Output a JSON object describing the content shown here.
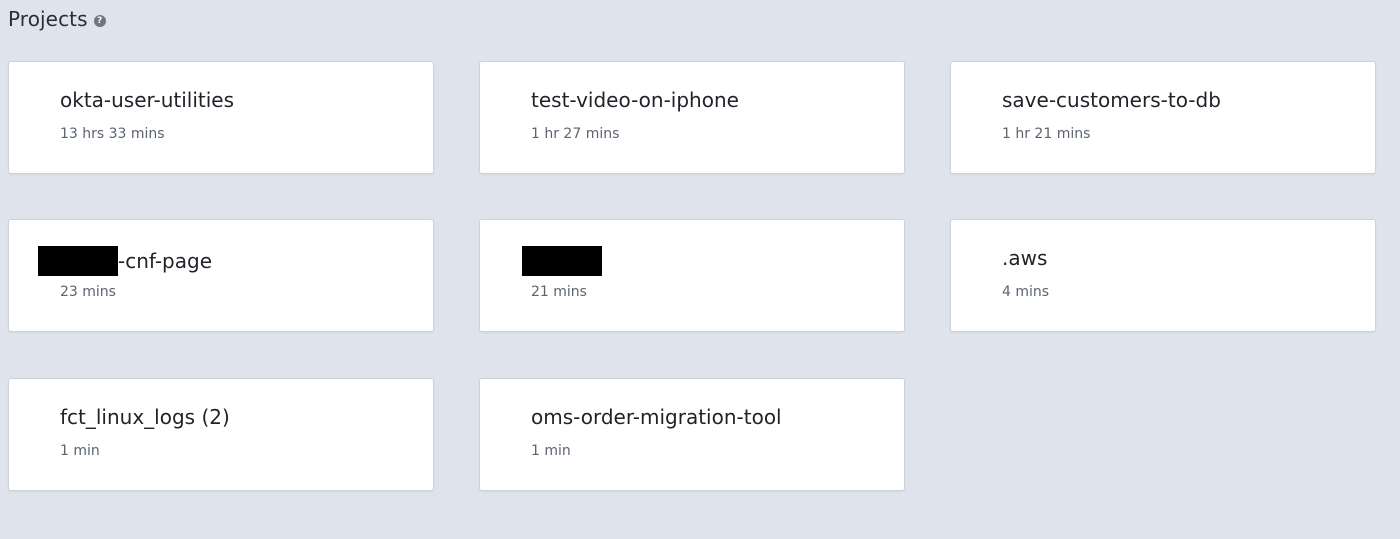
{
  "page": {
    "title": "Projects",
    "help_icon": "question-circle-icon"
  },
  "projects": [
    {
      "name": "okta-user-utilities",
      "duration": "13 hrs 33 mins"
    },
    {
      "name": "test-video-on-iphone",
      "duration": "1 hr 27 mins"
    },
    {
      "name": "save-customers-to-db",
      "duration": "1 hr 21 mins"
    },
    {
      "name_suffix": "-cnf-page",
      "duration": "23 mins",
      "redacted_prefix": true
    },
    {
      "name": "",
      "duration": "21 mins",
      "redacted": true
    },
    {
      "name": ".aws",
      "duration": "4 mins"
    },
    {
      "name": "fct_linux_logs (2)",
      "duration": "1 min"
    },
    {
      "name": "oms-order-migration-tool",
      "duration": "1 min"
    }
  ],
  "colors": {
    "background": "#dfe4ec",
    "card": "#ffffff",
    "text": "#1f2328",
    "muted": "#5c6470"
  }
}
